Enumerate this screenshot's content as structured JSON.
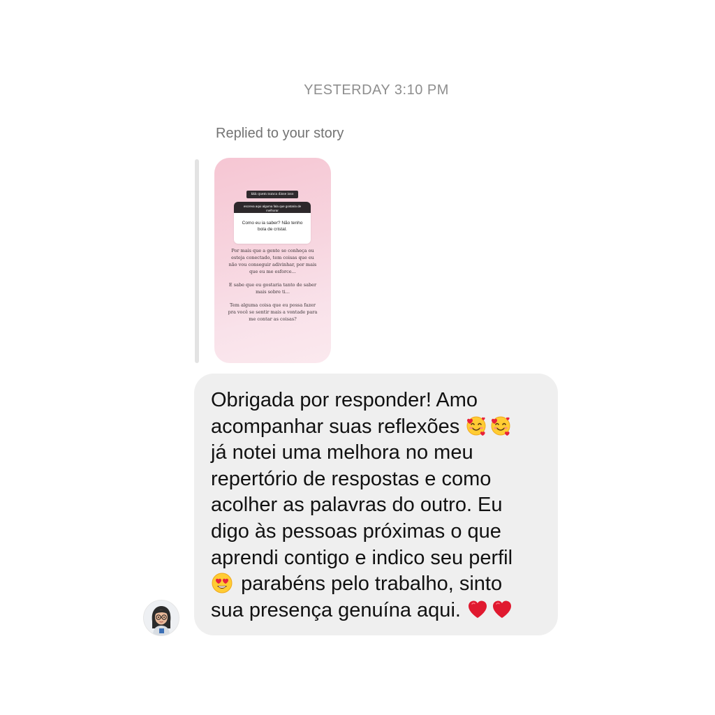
{
  "thread": {
    "timestamp": "YESTERDAY 3:10 PM"
  },
  "reply": {
    "label": "Replied to your story"
  },
  "story": {
    "header": "kkk quem nunca disse isso",
    "question_prompt": "escreva aqui alguma fala que gostaria de melhorar",
    "question_answer": "Como eu ia saber? Não tenho bola de cristal.",
    "paragraph_1": "Por mais que a gente se conheça ou esteja conectado, tem coisas que eu não vou conseguir adivinhar, por mais que eu me esforce...",
    "paragraph_2": "E sabe que eu gostaria tanto de saber mais sobre ti...",
    "paragraph_3": "Tem alguma coisa que eu possa fazer pra você se sentir mais a vontade para me contar as coisas?"
  },
  "message": {
    "lines": [
      "Obrigada por responder! Amo",
      "acompanhar suas reflexões",
      "já notei uma melhora no meu",
      "repertório de respostas e como",
      "acolher as palavras do outro. Eu",
      "digo às pessoas próximas o que",
      "aprendi contigo e indico seu perfil",
      "parabéns pelo trabalho, sinto",
      "sua presença genuína aqui."
    ],
    "emojis": [
      "smiling-face-with-hearts",
      "smiling-face-with-hearts",
      "heart-eyes-face",
      "red-heart",
      "red-heart"
    ]
  },
  "colors": {
    "bubble_background": "#efefef",
    "timestamp_text": "#8e8e8e",
    "reply_bar": "#e3e3e3",
    "story_gradient_top": "#f6c6d3",
    "story_gradient_bottom": "#fbe9ee"
  }
}
